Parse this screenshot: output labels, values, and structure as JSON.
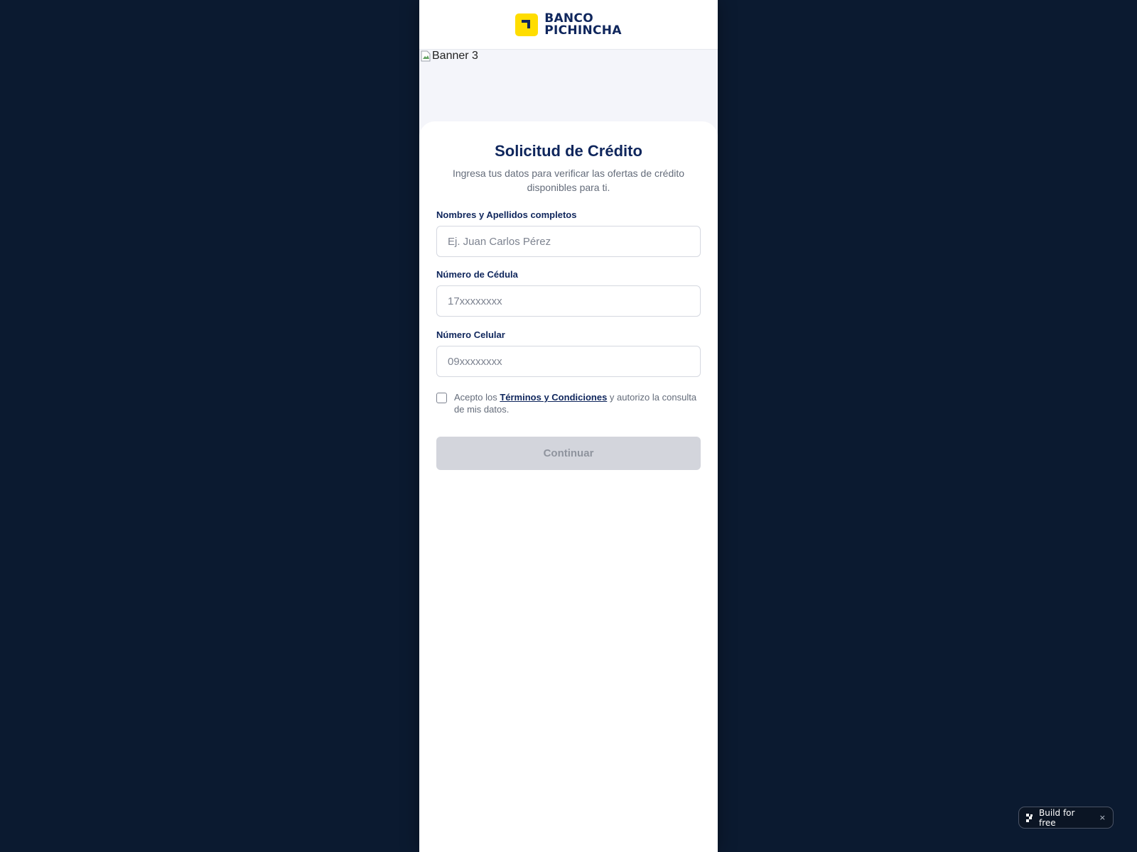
{
  "header": {
    "logo_line1": "BANCO",
    "logo_line2": "PICHINCHA"
  },
  "banner": {
    "alt_text": "Banner 3"
  },
  "form": {
    "title": "Solicitud de Crédito",
    "subtitle": "Ingresa tus datos para verificar las ofertas de crédito disponibles para ti.",
    "fields": [
      {
        "label": "Nombres y Apellidos completos",
        "placeholder": "Ej. Juan Carlos Pérez",
        "value": ""
      },
      {
        "label": "Número de Cédula",
        "placeholder": "17xxxxxxxx",
        "value": ""
      },
      {
        "label": "Número Celular",
        "placeholder": "09xxxxxxxx",
        "value": ""
      }
    ],
    "terms": {
      "prefix": "Acepto los ",
      "link": "Términos y Condiciones",
      "suffix": " y autorizo la consulta de mis datos.",
      "checked": false
    },
    "submit_label": "Continuar"
  },
  "badge": {
    "label": "Build for free",
    "close": "×"
  },
  "colors": {
    "page_background": "#0b1a30",
    "brand_navy": "#0f265c",
    "brand_yellow": "#ffdd00",
    "disabled_button": "#d3d5dc"
  }
}
